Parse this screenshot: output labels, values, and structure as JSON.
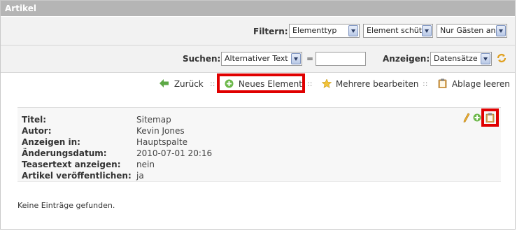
{
  "panel": {
    "title": "Artikel"
  },
  "filter": {
    "label": "Filtern:",
    "selects": [
      "Elementtyp",
      "Element schütz",
      "Nur Gästen anz"
    ]
  },
  "search": {
    "label": "Suchen:",
    "field_select": "Alternativer Text",
    "operator": "=",
    "value": "",
    "show_label": "Anzeigen:",
    "show_select": "Datensätze"
  },
  "actions": {
    "back": "Zurück",
    "new_element": "Neues Element",
    "edit_multiple": "Mehrere bearbeiten",
    "clear_clipboard": "Ablage leeren",
    "separator": "::"
  },
  "record": {
    "rows": [
      {
        "key": "Titel:",
        "value": "Sitemap"
      },
      {
        "key": "Autor:",
        "value": "Kevin Jones"
      },
      {
        "key": "Anzeigen in:",
        "value": "Hauptspalte"
      },
      {
        "key": "Änderungsdatum:",
        "value": "2010-07-01 20:16"
      },
      {
        "key": "Teasertext anzeigen:",
        "value": "nein"
      },
      {
        "key": "Artikel veröffentlichen:",
        "value": "ja"
      }
    ]
  },
  "empty_message": "Keine Einträge gefunden.",
  "colors": {
    "highlight": "#e00000",
    "titlebar": "#b5b5b5",
    "toolbar_bg": "#f2f2f2",
    "record_bg": "#f7f7f7"
  },
  "icons": [
    "arrow-left-icon",
    "plus-circle-icon",
    "star-icon",
    "clipboard-icon",
    "refresh-icon",
    "pencil-icon"
  ]
}
